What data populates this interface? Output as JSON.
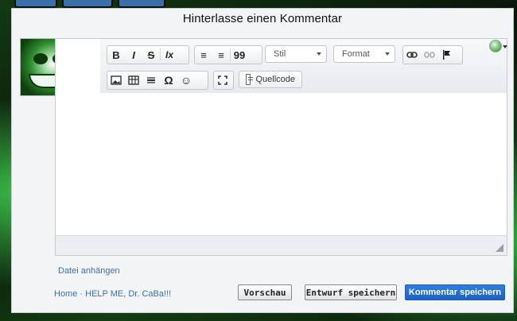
{
  "page": {
    "title": "Hinterlasse einen Kommentar"
  },
  "toolbar": {
    "row1": {
      "bold": "B",
      "italic": "I",
      "strike": "S",
      "clear_format": "Ix",
      "numbered_list": "≡",
      "bulleted_list": "≡",
      "blockquote": "99",
      "style_combo": "Stil",
      "format_combo": "Format",
      "link_icon": "link-icon",
      "unlink_icon": "unlink-icon",
      "flag_icon": "flag-icon"
    },
    "row2": {
      "image_icon": "image-icon",
      "table_icon": "table-icon",
      "hr_icon": "horizontal-line-icon",
      "omega": "Ω",
      "smiley": "☺",
      "fullscreen_icon": "fullscreen-icon",
      "source": "Quellcode"
    }
  },
  "links": {
    "attach": "Datei anhängen",
    "home": "Home",
    "separator": "·",
    "post": "HELP ME, Dr. CaBa!!!"
  },
  "buttons": {
    "preview": "Vorschau",
    "draft": "Entwurf speichern",
    "save": "Kommentar speichern"
  }
}
